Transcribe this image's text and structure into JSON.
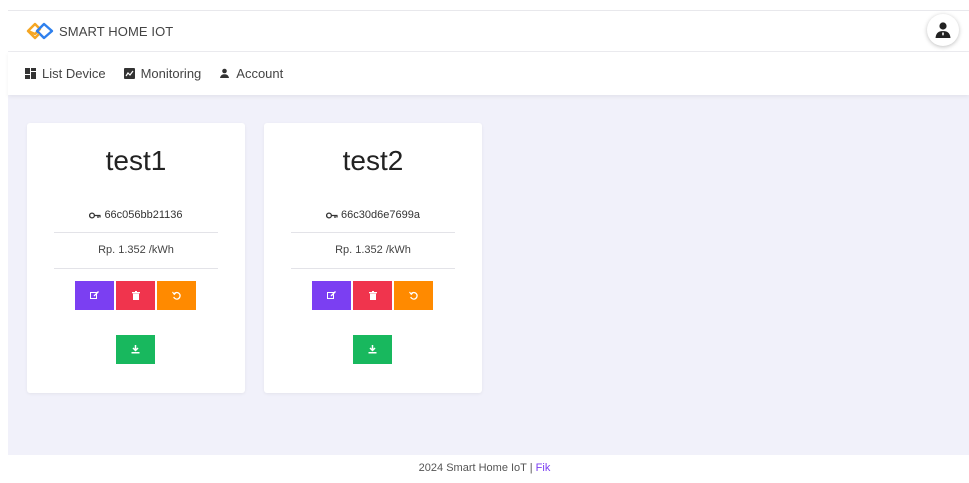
{
  "header": {
    "brand_name": "SMART HOME IOT",
    "logo_colors": [
      "#f5a623",
      "#2f80ed"
    ]
  },
  "nav": {
    "items": [
      {
        "label": "List Device",
        "icon": "dashboard-icon"
      },
      {
        "label": "Monitoring",
        "icon": "monitor-icon"
      },
      {
        "label": "Account",
        "icon": "person-icon"
      }
    ]
  },
  "devices": [
    {
      "name": "test1",
      "key": "66c056bb21136",
      "price": "Rp. 1.352 /kWh"
    },
    {
      "name": "test2",
      "key": "66c30d6e7699a",
      "price": "Rp. 1.352 /kWh"
    }
  ],
  "footer": {
    "text": "2024 Smart Home IoT | ",
    "author": "Fik"
  },
  "colors": {
    "edit": "#7b3ff2",
    "delete": "#f0344d",
    "reset": "#ff8a00",
    "download": "#18b85e",
    "background": "#f1f1fa"
  }
}
